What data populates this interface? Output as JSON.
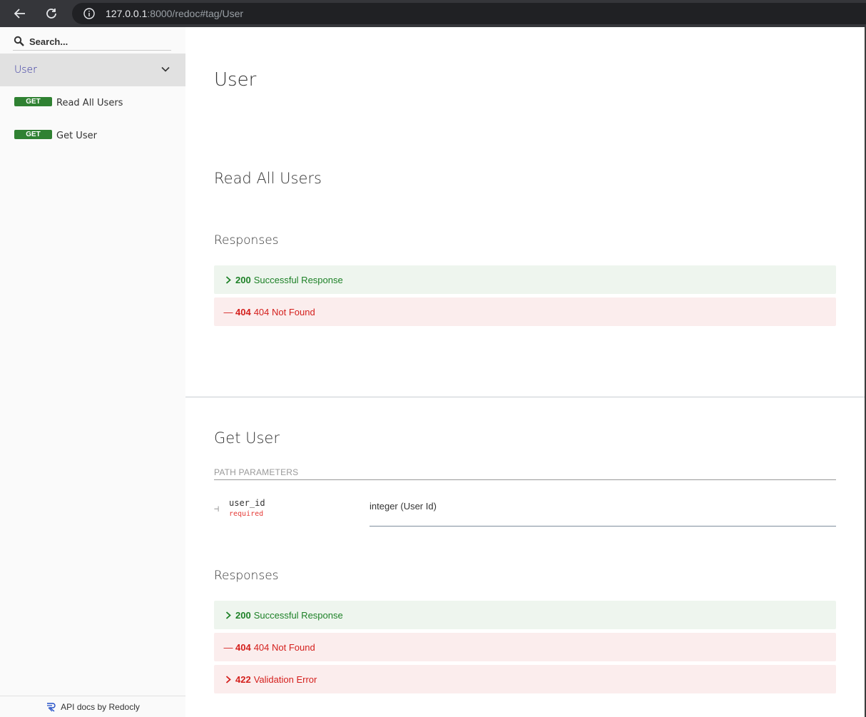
{
  "browser": {
    "url_host": "127.0.0.1",
    "url_rest": ":8000/redoc#tag/User"
  },
  "sidebar": {
    "search_placeholder": "Search...",
    "group_label": "User",
    "items": [
      {
        "method": "GET",
        "label": "Read All Users"
      },
      {
        "method": "GET",
        "label": "Get User"
      }
    ],
    "footer": "API docs by Redocly"
  },
  "main": {
    "tag_title": "User",
    "operations": [
      {
        "title": "Read All Users",
        "responses_heading": "Responses",
        "responses": [
          {
            "marker": ">",
            "code": "200",
            "text": "Successful Response"
          },
          {
            "marker": "—",
            "code": "404",
            "text": "404 Not Found"
          }
        ]
      },
      {
        "title": "Get User",
        "path_params_heading": "PATH PARAMETERS",
        "param": {
          "name": "user_id",
          "required": "required",
          "type": "integer (User Id)"
        },
        "responses_heading": "Responses",
        "responses": [
          {
            "marker": ">",
            "code": "200",
            "text": "Successful Response"
          },
          {
            "marker": "—",
            "code": "404",
            "text": "404 Not Found"
          },
          {
            "marker": ">",
            "code": "422",
            "text": "Validation Error"
          }
        ]
      }
    ]
  },
  "colors": {
    "get_badge": "#2f8132",
    "success": "#1d8127",
    "error": "#d41f1c",
    "success_bg": "#eef5ee",
    "error_bg": "#fbeded"
  }
}
